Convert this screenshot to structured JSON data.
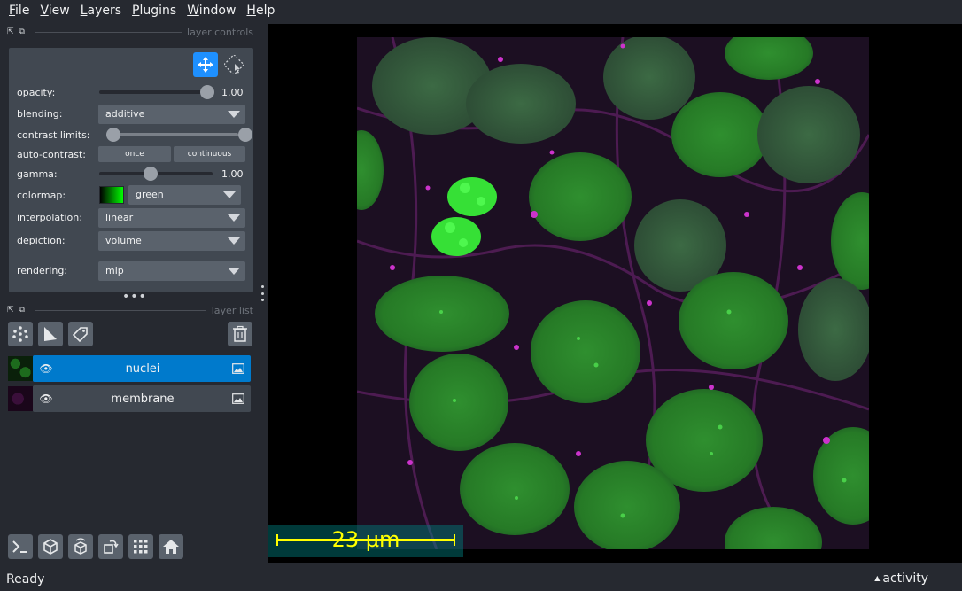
{
  "menu": [
    {
      "label": "File",
      "mn": "F",
      "rest": "ile"
    },
    {
      "label": "View",
      "mn": "V",
      "rest": "iew"
    },
    {
      "label": "Layers",
      "mn": "L",
      "rest": "ayers"
    },
    {
      "label": "Plugins",
      "mn": "P",
      "rest": "lugins"
    },
    {
      "label": "Window",
      "mn": "W",
      "rest": "indow"
    },
    {
      "label": "Help",
      "mn": "H",
      "rest": "elp"
    }
  ],
  "layer_controls": {
    "title": "layer controls",
    "opacity": {
      "label": "opacity:",
      "value": 1.0,
      "display": "1.00"
    },
    "blending": {
      "label": "blending:",
      "value": "additive"
    },
    "contrast_limits": {
      "label": "contrast limits:",
      "low": 0.0,
      "high": 1.0
    },
    "auto_contrast": {
      "label": "auto-contrast:",
      "once": "once",
      "continuous": "continuous"
    },
    "gamma": {
      "label": "gamma:",
      "value": 1.0,
      "display": "1.00",
      "fraction": 0.45
    },
    "colormap": {
      "label": "colormap:",
      "value": "green"
    },
    "interpolation": {
      "label": "interpolation:",
      "value": "linear"
    },
    "depiction": {
      "label": "depiction:",
      "value": "volume"
    },
    "rendering": {
      "label": "rendering:",
      "value": "mip"
    }
  },
  "layer_list": {
    "title": "layer list",
    "layers": [
      {
        "name": "nuclei",
        "selected": true
      },
      {
        "name": "membrane",
        "selected": false
      }
    ]
  },
  "scalebar": {
    "text": "23 µm"
  },
  "status": {
    "text": "Ready",
    "activity": "activity"
  },
  "colors": {
    "background": "#262930",
    "panel": "#414851",
    "selected": "#007acc",
    "accent_blue": "#1e90ff",
    "scalebar": "#ffff00",
    "nuclei": "#22cc22",
    "membrane": "#8a2a8a"
  }
}
